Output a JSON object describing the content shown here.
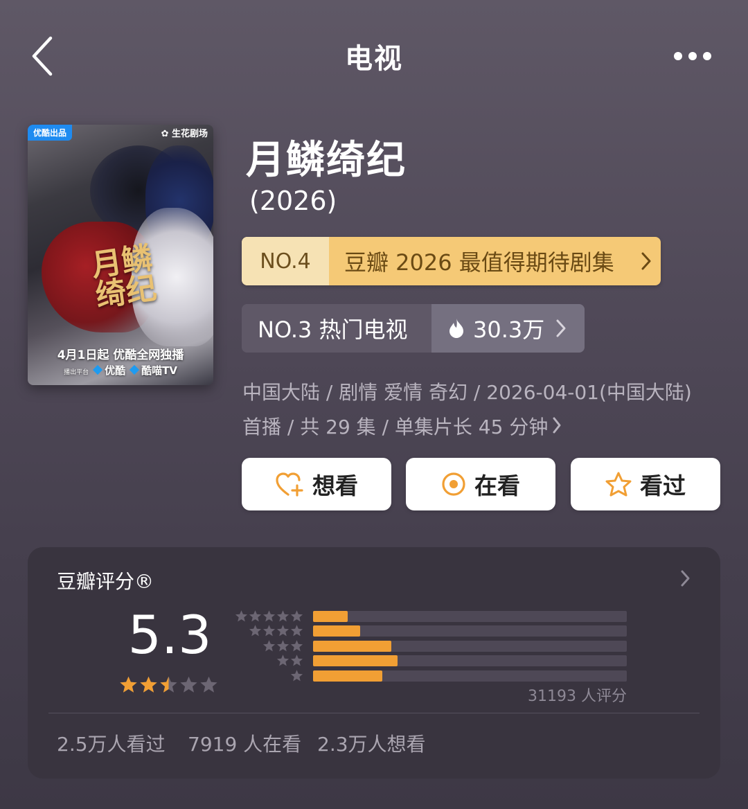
{
  "header": {
    "title": "电视",
    "back_icon": "chevron-left-icon",
    "more_icon": "more-dots-icon"
  },
  "poster": {
    "badge_left": "优酷出品",
    "badge_right": "生花剧场",
    "title_art": "月鳞绮纪",
    "release_line": "4月1日起 优酷全网独播",
    "platform_prefix": "播出平台",
    "platform_1": "优酷",
    "platform_2": "酷喵TV"
  },
  "show": {
    "title": "月鳞绮纪",
    "year": "(2026)"
  },
  "rank_badges": {
    "anticipated": {
      "rank": "NO.4",
      "label": "豆瓣 2026 最值得期待剧集",
      "color": "#f5c976"
    },
    "hot": {
      "rank": "NO.3 热门电视",
      "heat": "30.3万"
    }
  },
  "meta": {
    "line1": "中国大陆 / 剧情 爱情 奇幻 / 2026-04-01(中国大陆)",
    "line2": "首播 / 共 29 集 / 单集片长 45 分钟"
  },
  "actions": {
    "want": "想看",
    "watching": "在看",
    "watched": "看过",
    "accent_color": "#f19f34"
  },
  "rating": {
    "title": "豆瓣评分®",
    "score": "5.3",
    "score_stars": 2.5,
    "votes": "31193 人评分",
    "distribution": [
      {
        "stars": 5,
        "ratio": 0.11
      },
      {
        "stars": 4,
        "ratio": 0.15
      },
      {
        "stars": 3,
        "ratio": 0.25
      },
      {
        "stars": 2,
        "ratio": 0.27
      },
      {
        "stars": 1,
        "ratio": 0.22
      }
    ],
    "bar_color": "#f19f34"
  },
  "stats": {
    "watched": "2.5万人看过",
    "watching": "7919 人在看",
    "want": "2.3万人想看"
  }
}
